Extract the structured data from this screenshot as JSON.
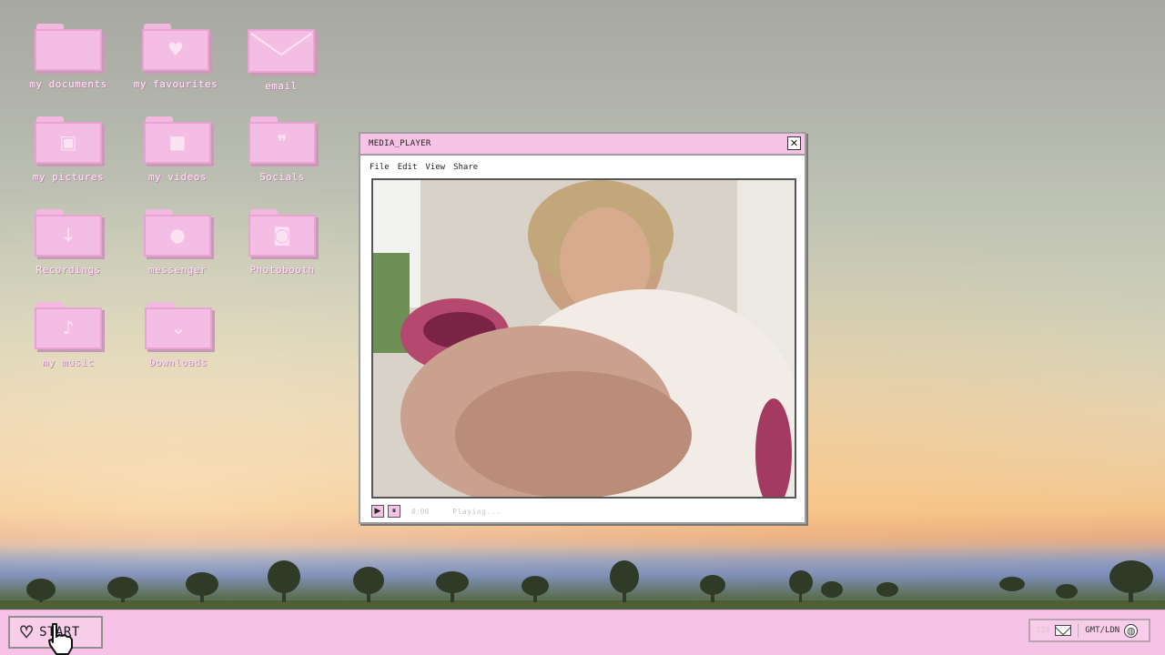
{
  "desktop": {
    "icons": [
      {
        "label": "my documents",
        "icon": "folder-icon",
        "glyph": ""
      },
      {
        "label": "my favourites",
        "icon": "heart-folder-icon",
        "glyph": "♥"
      },
      {
        "label": "email",
        "icon": "envelope-icon",
        "glyph": ""
      },
      {
        "label": "my pictures",
        "icon": "picture-folder-icon",
        "glyph": "▣"
      },
      {
        "label": "my videos",
        "icon": "video-folder-icon",
        "glyph": "■"
      },
      {
        "label": "Socials",
        "icon": "quote-folder-icon",
        "glyph": "❞"
      },
      {
        "label": "Recordings",
        "icon": "download-arrow-folder-icon",
        "glyph": "↓"
      },
      {
        "label": "messenger",
        "icon": "speech-bubble-folder-icon",
        "glyph": "●"
      },
      {
        "label": "Photobooth",
        "icon": "camera-folder-icon",
        "glyph": "◙"
      },
      {
        "label": "my music",
        "icon": "music-note-folder-icon",
        "glyph": "♪"
      },
      {
        "label": "Downloads",
        "icon": "chevrons-down-folder-icon",
        "glyph": "⌄"
      }
    ]
  },
  "window": {
    "title": "MEDIA_PLAYER",
    "close_glyph": "✕",
    "menu": [
      "File",
      "Edit",
      "View",
      "Share"
    ],
    "controls": {
      "play_glyph": "▶",
      "pause_glyph": "⏸",
      "time": "0:00",
      "status": "Playing..."
    }
  },
  "taskbar": {
    "start_label": "START",
    "start_glyph": "♡",
    "tray": {
      "mail_count": "120",
      "timezone": "GMT/LDN",
      "globe_glyph": "◍"
    }
  },
  "colors": {
    "accent_pink": "#f6c3e6",
    "folder_pink": "#f4bde3",
    "border_grey": "#9e9e9e"
  }
}
